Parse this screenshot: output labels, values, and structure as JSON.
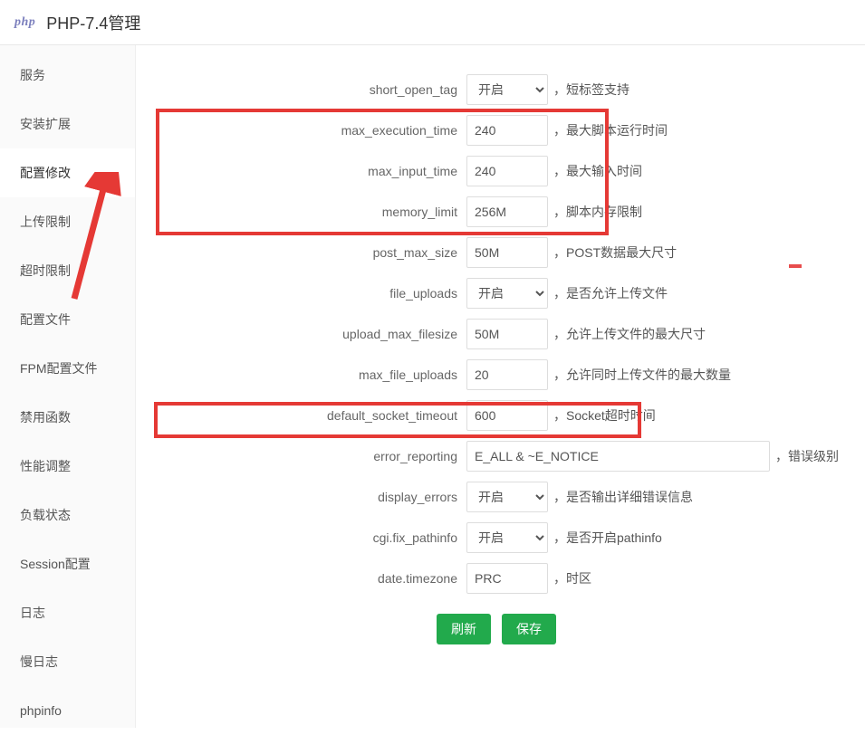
{
  "title": "PHP-7.4管理",
  "logo_text": "php",
  "sidebar": {
    "items": [
      {
        "label": "服务"
      },
      {
        "label": "安装扩展"
      },
      {
        "label": "配置修改"
      },
      {
        "label": "上传限制"
      },
      {
        "label": "超时限制"
      },
      {
        "label": "配置文件"
      },
      {
        "label": "FPM配置文件"
      },
      {
        "label": "禁用函数"
      },
      {
        "label": "性能调整"
      },
      {
        "label": "负载状态"
      },
      {
        "label": "Session配置"
      },
      {
        "label": "日志"
      },
      {
        "label": "慢日志"
      },
      {
        "label": "phpinfo"
      }
    ],
    "active_index": 2
  },
  "select_option_on": "开启",
  "rows": [
    {
      "label": "short_open_tag",
      "type": "select",
      "value": "开启",
      "hint": "，短标签支持"
    },
    {
      "label": "max_execution_time",
      "type": "text",
      "value": "240",
      "hint": "，最大脚本运行时间"
    },
    {
      "label": "max_input_time",
      "type": "text",
      "value": "240",
      "hint": "，最大输入时间"
    },
    {
      "label": "memory_limit",
      "type": "text",
      "value": "256M",
      "hint": "，脚本内存限制"
    },
    {
      "label": "post_max_size",
      "type": "text",
      "value": "50M",
      "hint": "，POST数据最大尺寸"
    },
    {
      "label": "file_uploads",
      "type": "select",
      "value": "开启",
      "hint": "，是否允许上传文件"
    },
    {
      "label": "upload_max_filesize",
      "type": "text",
      "value": "50M",
      "hint": "，允许上传文件的最大尺寸"
    },
    {
      "label": "max_file_uploads",
      "type": "text",
      "value": "20",
      "hint": "，允许同时上传文件的最大数量"
    },
    {
      "label": "default_socket_timeout",
      "type": "text",
      "value": "600",
      "hint": "，Socket超时时间"
    },
    {
      "label": "error_reporting",
      "type": "wide",
      "value": "E_ALL & ~E_NOTICE",
      "hint": "，错误级别"
    },
    {
      "label": "display_errors",
      "type": "select",
      "value": "开启",
      "hint": "，是否输出详细错误信息"
    },
    {
      "label": "cgi.fix_pathinfo",
      "type": "select",
      "value": "开启",
      "hint": "，是否开启pathinfo"
    },
    {
      "label": "date.timezone",
      "type": "text",
      "value": "PRC",
      "hint": "，时区"
    }
  ],
  "buttons": {
    "refresh": "刷新",
    "save": "保存"
  }
}
